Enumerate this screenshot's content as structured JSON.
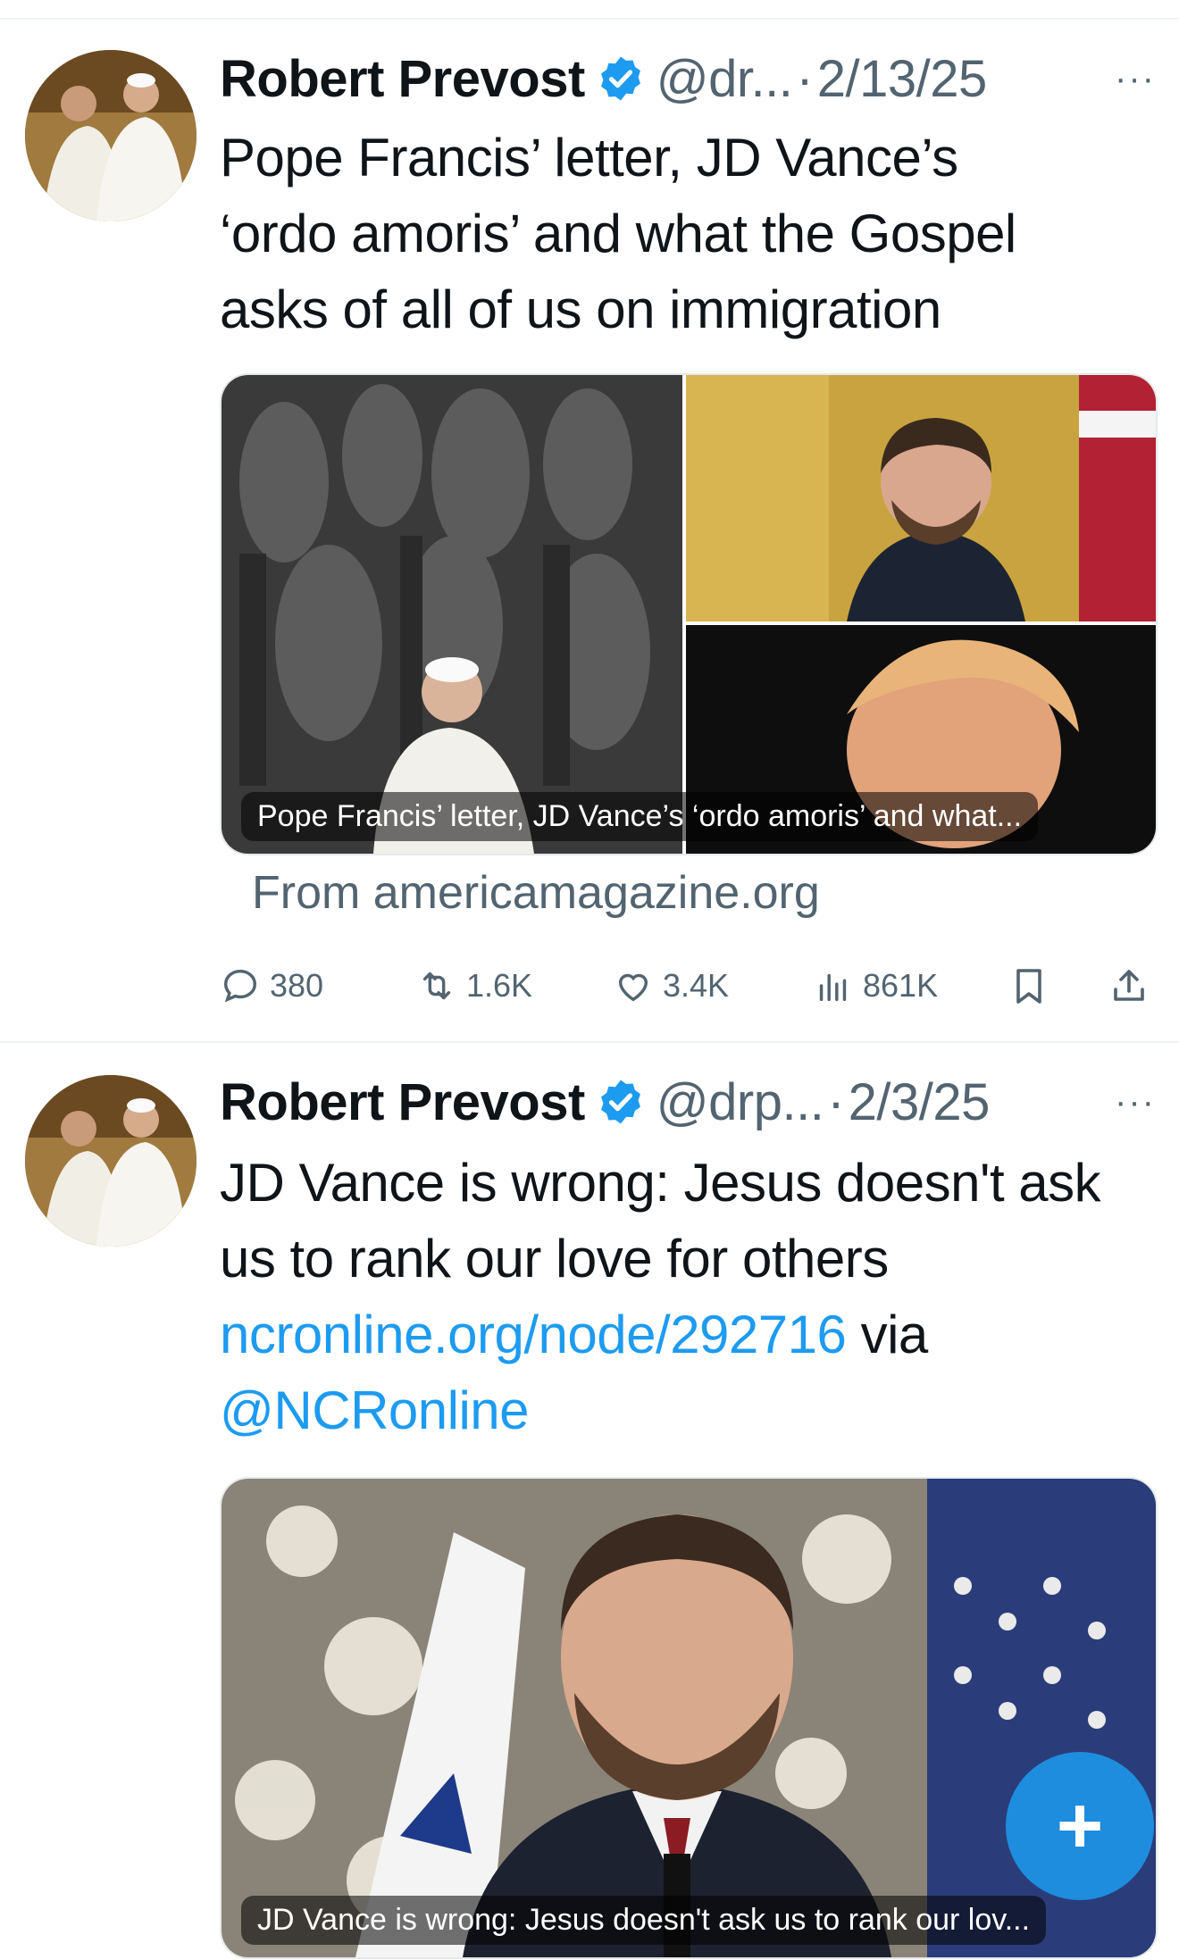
{
  "tweets": [
    {
      "author_name": "Robert Prevost",
      "handle": "@dr...",
      "separator": "·",
      "date": "2/13/25",
      "more": "···",
      "text_lines": [
        "Pope Francis’ letter, JD Vance’s",
        "‘ordo amoris’ and what the Gospel",
        "asks of all of us on immigration"
      ],
      "card_caption": "Pope Francis’ letter, JD Vance’s ‘ordo amoris’ and what...",
      "source": "From americamagazine.org",
      "replies": "380",
      "reposts": "1.6K",
      "likes": "3.4K",
      "views": "861K"
    },
    {
      "author_name": "Robert Prevost",
      "handle": "@drp...",
      "separator": "·",
      "date": "2/3/25",
      "more": "···",
      "text_line1": "JD Vance is wrong: Jesus doesn't ask",
      "text_line2": "us to rank our love for others",
      "link": "ncronline.org/node/292716",
      "via": " via",
      "mention": "@NCRonline",
      "card_caption": "JD Vance is wrong: Jesus doesn't ask us to rank our lov..."
    }
  ],
  "fab_label": "+",
  "colors": {
    "accent": "#1d9bf0",
    "secondary_text": "#536471"
  }
}
